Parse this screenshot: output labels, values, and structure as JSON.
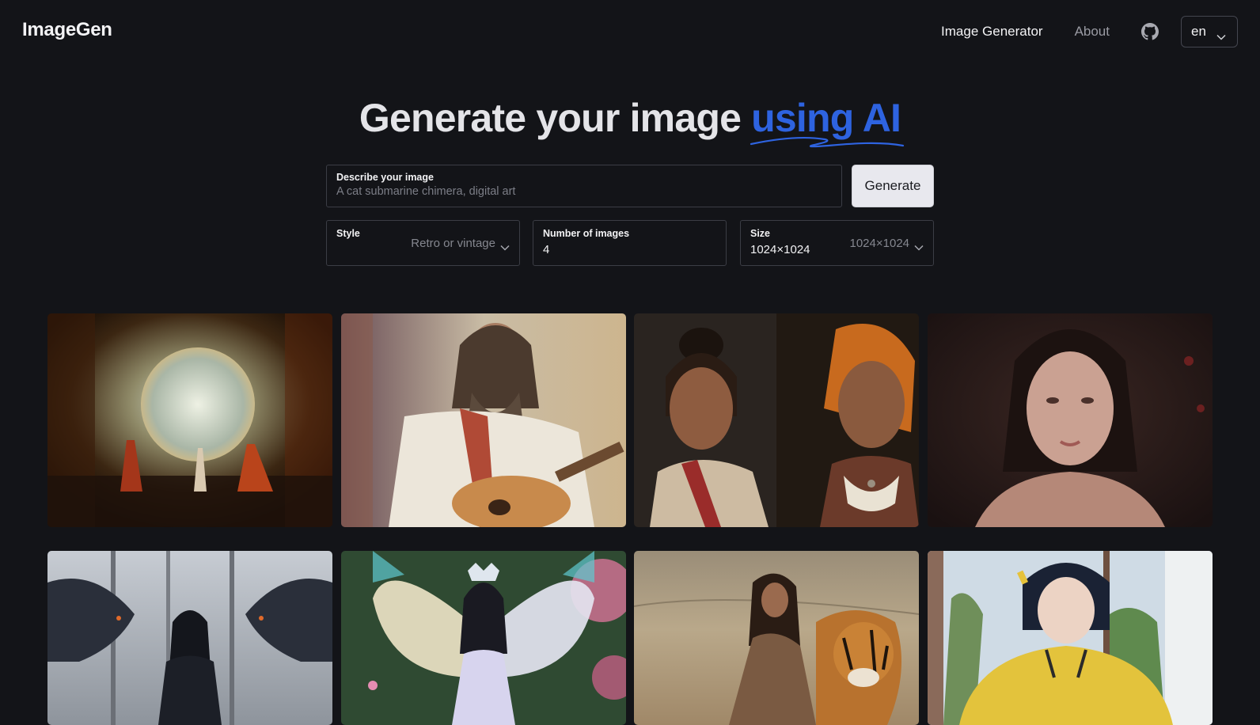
{
  "header": {
    "logo": "ImageGen",
    "nav": {
      "generator": "Image Generator",
      "about": "About"
    },
    "github_icon": "github-icon",
    "language": "en"
  },
  "hero": {
    "title_main": "Generate your image ",
    "title_accent": "using AI",
    "accent_color": "#2e63e0"
  },
  "prompt": {
    "label": "Describe your image",
    "placeholder": "A cat submarine chimera, digital art",
    "value": ""
  },
  "generate_button": "Generate",
  "options": {
    "style": {
      "label": "Style",
      "selected": "Retro or vintage"
    },
    "num_images": {
      "label": "Number of images",
      "value": "4"
    },
    "size": {
      "label": "Size",
      "value": "1024×1024",
      "selected": "1024×1024"
    }
  },
  "gallery": [
    "fantasy-palace-portal-image",
    "bearded-guitarist-painting-image",
    "two-women-portrait-image",
    "young-woman-portrait-image",
    "woman-with-dragons-forest-image",
    "fairy-girl-butterfly-wings-image",
    "woman-with-tiger-desert-image",
    "girl-yellow-hoodie-image"
  ]
}
